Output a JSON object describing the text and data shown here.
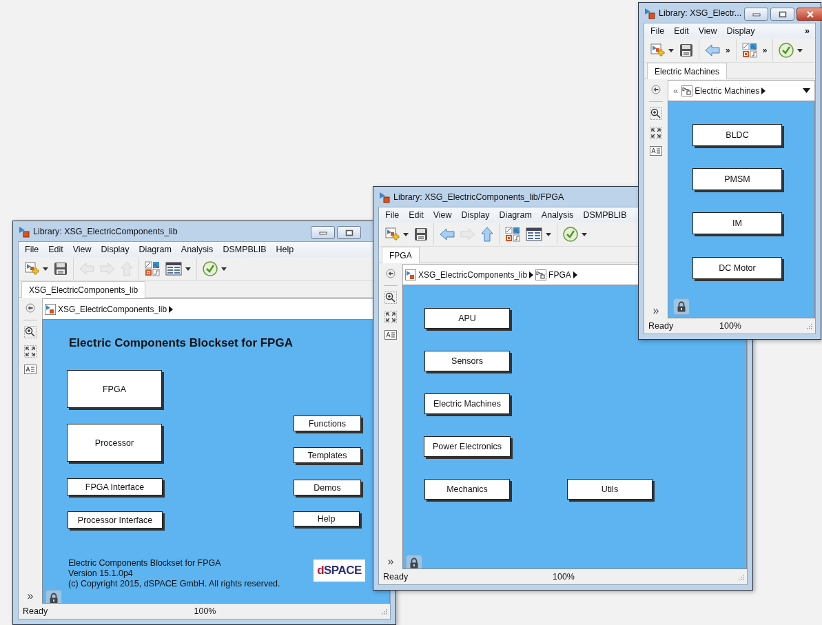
{
  "windows": [
    {
      "title": "Library: XSG_ElectricComponents_lib",
      "title_buttons": [
        {
          "kind": "minimize"
        },
        {
          "kind": "maximize"
        }
      ],
      "menu": [
        "File",
        "Edit",
        "View",
        "Display",
        "Diagram",
        "Analysis",
        "DSMPBLIB",
        "Help"
      ],
      "toolbar": [
        {
          "kind": "new",
          "disabled": false,
          "caret": true
        },
        {
          "kind": "save",
          "disabled": false,
          "caret": false
        },
        {
          "kind": "separator"
        },
        {
          "kind": "back",
          "disabled": true,
          "caret": false
        },
        {
          "kind": "forward",
          "disabled": true,
          "caret": false
        },
        {
          "kind": "up",
          "disabled": true,
          "caret": false
        },
        {
          "kind": "separator"
        },
        {
          "kind": "browser",
          "disabled": false,
          "caret": false
        },
        {
          "kind": "config",
          "disabled": false,
          "caret": true
        },
        {
          "kind": "separator"
        },
        {
          "kind": "check",
          "disabled": false,
          "caret": true
        }
      ],
      "tabs": [
        {
          "label": "XSG_ElectricComponents_lib",
          "selected": true
        }
      ],
      "breadcrumb": {
        "items": [
          {
            "label": "XSG_ElectricComponents_lib",
            "kind": "library"
          }
        ],
        "dropdown": false
      },
      "palette_more": "»",
      "canvas": {
        "heading": "Electric Components Blockset for FPGA",
        "blocks": [
          {
            "label": "FPGA"
          },
          {
            "label": "Processor"
          },
          {
            "label": "FPGA Interface"
          },
          {
            "label": "Processor Interface"
          },
          {
            "label": "Functions"
          },
          {
            "label": "Templates"
          },
          {
            "label": "Demos"
          },
          {
            "label": "Help"
          }
        ],
        "notes": [
          "Electric Components Blockset for FPGA",
          "Version 15.1.0p4",
          "(c) Copyright 2015, dSPACE GmbH. All rights reserved."
        ],
        "logo": "dSPACE"
      },
      "status": {
        "state": "Ready",
        "zoom": "100%"
      }
    },
    {
      "title": "Library: XSG_ElectricComponents_lib/FPGA",
      "menu": [
        "File",
        "Edit",
        "View",
        "Display",
        "Diagram",
        "Analysis",
        "DSMPBLIB"
      ],
      "toolbar": [
        {
          "kind": "new",
          "disabled": false,
          "caret": true
        },
        {
          "kind": "save",
          "disabled": false,
          "caret": false
        },
        {
          "kind": "separator"
        },
        {
          "kind": "back",
          "disabled": false,
          "caret": false
        },
        {
          "kind": "forward",
          "disabled": true,
          "caret": false
        },
        {
          "kind": "up",
          "disabled": false,
          "caret": false
        },
        {
          "kind": "separator"
        },
        {
          "kind": "browser",
          "disabled": false,
          "caret": false
        },
        {
          "kind": "config",
          "disabled": false,
          "caret": true
        },
        {
          "kind": "separator"
        },
        {
          "kind": "check",
          "disabled": false,
          "caret": true
        }
      ],
      "tabs": [
        {
          "label": "FPGA",
          "selected": true
        }
      ],
      "breadcrumb": {
        "items": [
          {
            "label": "XSG_ElectricComponents_lib",
            "kind": "library"
          },
          {
            "label": "FPGA",
            "kind": "subsystem"
          }
        ],
        "dropdown": false
      },
      "palette_more": "»",
      "canvas": {
        "blocks": [
          {
            "label": "APU"
          },
          {
            "label": "Sensors"
          },
          {
            "label": "Electric Machines"
          },
          {
            "label": "Power Electronics"
          },
          {
            "label": "Mechanics"
          },
          {
            "label": "Utils"
          }
        ]
      },
      "status": {
        "state": "Ready",
        "zoom": "100%"
      }
    },
    {
      "title": "Library: XSG_Electr...",
      "title_buttons": [
        {
          "kind": "minimize"
        },
        {
          "kind": "maximize"
        },
        {
          "kind": "close"
        }
      ],
      "menu": [
        "File",
        "Edit",
        "View",
        "Display"
      ],
      "menu_more": "»",
      "toolbar": [
        {
          "kind": "new",
          "disabled": false,
          "caret": true
        },
        {
          "kind": "save",
          "disabled": false,
          "caret": false
        },
        {
          "kind": "separator"
        },
        {
          "kind": "back",
          "disabled": false,
          "caret": false
        },
        {
          "kind": "more",
          "text": "»"
        },
        {
          "kind": "separator"
        },
        {
          "kind": "browser",
          "disabled": false,
          "caret": false
        },
        {
          "kind": "more",
          "text": "»"
        },
        {
          "kind": "separator"
        },
        {
          "kind": "check",
          "disabled": false,
          "caret": true
        }
      ],
      "tabs": [
        {
          "label": "Electric Machines",
          "selected": true
        }
      ],
      "breadcrumb": {
        "back": "«",
        "items": [
          {
            "label": "Electric Machines",
            "kind": "subsystem"
          }
        ],
        "dropdown": true
      },
      "palette_more": "»",
      "canvas": {
        "blocks": [
          {
            "label": "BLDC"
          },
          {
            "label": "PMSM"
          },
          {
            "label": "IM"
          },
          {
            "label": "DC Motor"
          }
        ]
      },
      "status": {
        "state": "Ready",
        "zoom": "100%"
      }
    }
  ]
}
